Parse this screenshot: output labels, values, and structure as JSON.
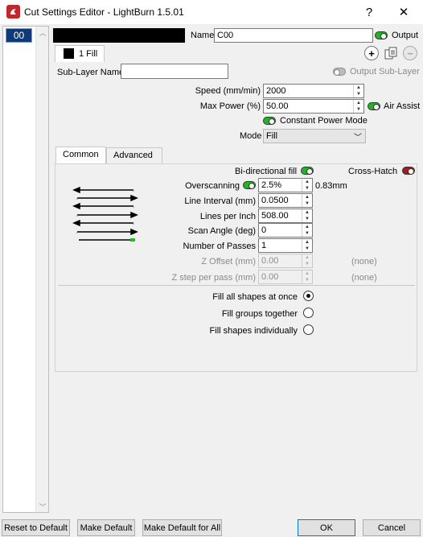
{
  "window": {
    "title": "Cut Settings Editor - LightBurn 1.5.01",
    "help_glyph": "?",
    "close_glyph": "✕"
  },
  "layers": [
    {
      "id": "00"
    }
  ],
  "header": {
    "name_label": "Name",
    "name_value": "C00",
    "output_label": "Output"
  },
  "sublayers": {
    "tab_label": "1 Fill",
    "sub_layer_name_label": "Sub-Layer Name",
    "sub_layer_name_value": "",
    "output_sub_layer_label": "Output Sub-Layer"
  },
  "settings": {
    "speed_label": "Speed (mm/min)",
    "speed_value": "2000",
    "max_power_label": "Max Power (%)",
    "max_power_value": "50.00",
    "air_assist_label": "Air Assist",
    "constant_power_label": "Constant Power Mode",
    "mode_label": "Mode",
    "mode_value": "Fill"
  },
  "tabs": [
    {
      "label": "Common"
    },
    {
      "label": "Advanced"
    }
  ],
  "common": {
    "bidirectional_label": "Bi-directional fill",
    "crosshatch_label": "Cross-Hatch",
    "overscanning_label": "Overscanning",
    "overscanning_value": "2.5%",
    "overscanning_mm": "0.83mm",
    "line_interval_label": "Line Interval (mm)",
    "line_interval_value": "0.0500",
    "lines_per_inch_label": "Lines per Inch",
    "lines_per_inch_value": "508.00",
    "scan_angle_label": "Scan Angle (deg)",
    "scan_angle_value": "0",
    "passes_label": "Number of Passes",
    "passes_value": "1",
    "z_offset_label": "Z Offset (mm)",
    "z_offset_value": "0.00",
    "z_offset_none": "(none)",
    "z_step_label": "Z step per pass (mm)",
    "z_step_value": "0.00",
    "z_step_none": "(none)",
    "fill_all_label": "Fill all shapes at once",
    "fill_groups_label": "Fill groups together",
    "fill_individually_label": "Fill shapes individually"
  },
  "footer": {
    "reset_label": "Reset to Default",
    "make_default_label": "Make Default",
    "make_default_all_label": "Make Default for All",
    "ok_label": "OK",
    "cancel_label": "Cancel"
  },
  "colors": {
    "layer_chip_bg": "#0e3a78",
    "toggle_on": "#23b423",
    "toggle_crosshatch": "#a01e1e",
    "ok_border": "#0078d7"
  }
}
